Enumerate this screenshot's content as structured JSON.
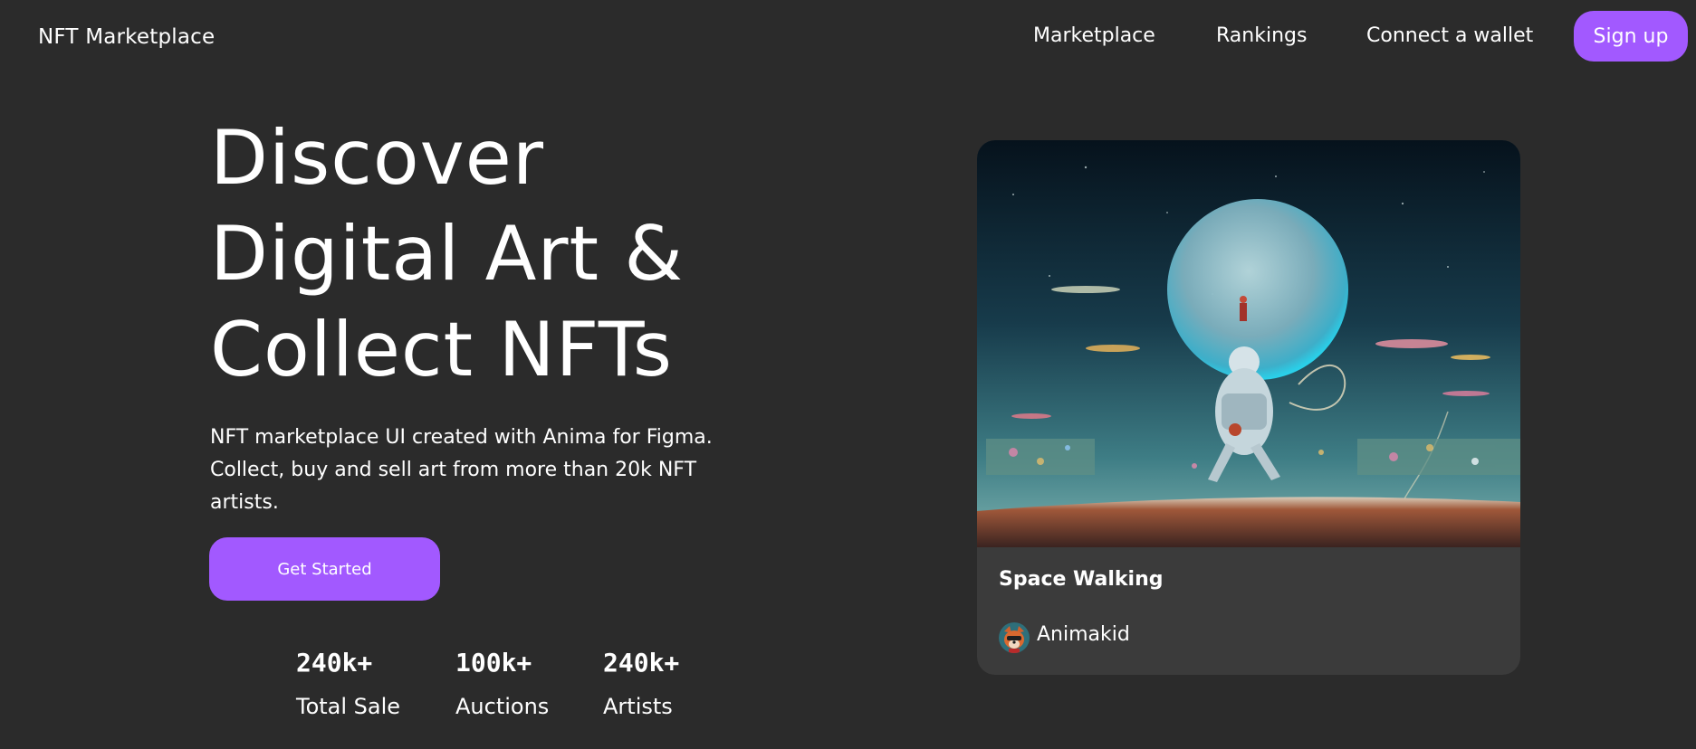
{
  "header": {
    "brand": "NFT Marketplace",
    "nav": [
      {
        "label": "Marketplace"
      },
      {
        "label": "Rankings"
      },
      {
        "label": "Connect a wallet"
      }
    ],
    "signup_label": "Sign up"
  },
  "hero": {
    "title_lines": [
      "Discover",
      "Digital Art &",
      "Collect NFTs"
    ],
    "description": "NFT marketplace UI created with Anima for Figma. Collect, buy and sell art from more than 20k NFT artists.",
    "cta_label": "Get Started",
    "stats": [
      {
        "value": "240k+",
        "label": "Total Sale"
      },
      {
        "value": "100k+",
        "label": "Auctions"
      },
      {
        "value": "240k+",
        "label": "Artists"
      }
    ]
  },
  "featured": {
    "title": "Space Walking",
    "artist": "Animakid"
  },
  "colors": {
    "background": "#2b2b2b",
    "accent": "#a259ff",
    "card": "#3b3b3b"
  }
}
